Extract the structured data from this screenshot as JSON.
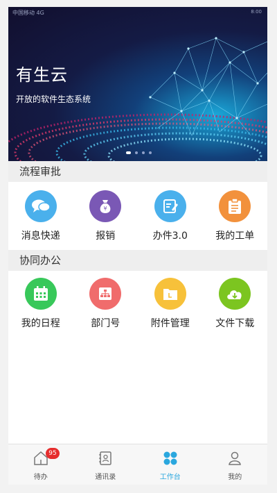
{
  "status_bar": {
    "left": "中国移动 4G",
    "right": "8:00"
  },
  "banner": {
    "title": "有生云",
    "subtitle": "开放的软件生态系统",
    "page_count": 4,
    "active_page": 1
  },
  "sections": [
    {
      "title": "流程审批",
      "items": [
        {
          "label": "消息快递",
          "icon": "chat-bubbles-icon",
          "color": "#4ab0ec"
        },
        {
          "label": "报销",
          "icon": "money-bag-icon",
          "color": "#7a58b5"
        },
        {
          "label": "办件3.0",
          "icon": "edit-document-icon",
          "color": "#4ab0ec"
        },
        {
          "label": "我的工单",
          "icon": "clipboard-icon",
          "color": "#f2913c"
        }
      ]
    },
    {
      "title": "协同办公",
      "items": [
        {
          "label": "我的日程",
          "icon": "calendar-icon",
          "color": "#38c85a"
        },
        {
          "label": "部门号",
          "icon": "org-chart-icon",
          "color": "#f06c6c"
        },
        {
          "label": "附件管理",
          "icon": "folder-icon",
          "color": "#f7c13a"
        },
        {
          "label": "文件下载",
          "icon": "cloud-download-icon",
          "color": "#7cc520"
        }
      ]
    }
  ],
  "tabbar": {
    "tabs": [
      {
        "label": "待办",
        "icon": "home-icon",
        "badge": "95"
      },
      {
        "label": "通讯录",
        "icon": "contacts-icon"
      },
      {
        "label": "工作台",
        "icon": "workbench-icon",
        "active": true
      },
      {
        "label": "我的",
        "icon": "person-icon"
      }
    ],
    "active_color": "#2aa7de"
  }
}
